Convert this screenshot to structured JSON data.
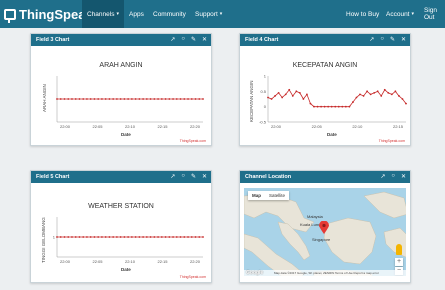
{
  "brand": {
    "name": "ThingSpeak",
    "tm": "™"
  },
  "nav": {
    "channels": "Channels",
    "apps": "Apps",
    "community": "Community",
    "support": "Support",
    "how_to_buy": "How to Buy",
    "account": "Account",
    "sign_out": "Sign Out"
  },
  "panel_icons": [
    "external-link-icon",
    "comment-icon",
    "pencil-icon",
    "close-icon"
  ],
  "charts": [
    {
      "header": "Field 3 Chart",
      "title": "ARAH ANGIN",
      "ylabel": "ARAH ANGIN",
      "xlabel": "Date",
      "credit": "ThingSpeak.com",
      "x_ticks": [
        "22:00",
        "22:05",
        "22:10",
        "22:15",
        "22:20"
      ]
    },
    {
      "header": "Field 4 Chart",
      "title": "KECEPATAN ANGIN",
      "ylabel": "KECEPATAN ANGIN",
      "xlabel": "Date",
      "credit": "ThingSpeak.com",
      "y_ticks": [
        "1",
        "0.5",
        "0",
        "-0.5"
      ],
      "x_ticks": [
        "22:00",
        "22:05",
        "22:10",
        "22:15"
      ]
    },
    {
      "header": "Field 5 Chart",
      "title": "WEATHER STATION",
      "ylabel": "TINGGI GELOMBANG",
      "xlabel": "Date",
      "credit": "ThingSpeak.com",
      "y_ticks": [
        "1"
      ],
      "x_ticks": [
        "22:00",
        "22:05",
        "22:10",
        "22:15",
        "22:20"
      ]
    }
  ],
  "map_panel": {
    "header": "Channel Location",
    "map_type_map": "Map",
    "map_type_sat": "Satellite",
    "labels": {
      "malaysia": "Malaysia",
      "kuala_lumpur": "Kuala Lumpur",
      "singapore": "Singapore"
    },
    "zoom_in": "+",
    "zoom_out": "−",
    "google": "Google",
    "footer": "Map data ©2017 Google, SK planet, ZENRIN  Terms of Use  Report a map error"
  },
  "chart_data": [
    {
      "type": "line",
      "title": "ARAH ANGIN",
      "xlabel": "Date",
      "ylabel": "ARAH ANGIN",
      "series": [
        {
          "values": [
            0,
            0,
            0,
            0,
            0,
            0,
            0,
            0,
            0,
            0,
            0,
            0,
            0,
            0,
            0,
            0,
            0,
            0,
            0,
            0,
            0,
            0,
            0,
            0,
            0,
            0,
            0,
            0,
            0,
            0,
            0,
            0,
            0,
            0,
            0,
            0,
            0,
            0,
            0,
            0
          ],
          "color": "#c62828"
        }
      ]
    },
    {
      "type": "line",
      "title": "KECEPATAN ANGIN",
      "xlabel": "Date",
      "ylabel": "KECEPATAN ANGIN",
      "ylim": [
        -0.5,
        1
      ],
      "series": [
        {
          "values": [
            0.3,
            0.25,
            0.35,
            0.45,
            0.3,
            0.4,
            0.55,
            0.35,
            0.5,
            0.45,
            0.25,
            0.4,
            0.1,
            0,
            0,
            0,
            0,
            0,
            0,
            0,
            0,
            0,
            0,
            0,
            0.15,
            0.3,
            0.4,
            0.35,
            0.5,
            0.4,
            0.45,
            0.5,
            0.35,
            0.55,
            0.45,
            0.4,
            0.5,
            0.35,
            0.25,
            0.1
          ],
          "color": "#c62828"
        }
      ]
    },
    {
      "type": "line",
      "title": "WEATHER STATION",
      "xlabel": "Date",
      "ylabel": "TINGGI GELOMBANG",
      "series": [
        {
          "values": [
            1,
            1,
            1,
            1,
            1,
            1,
            1,
            1,
            1,
            1,
            1,
            1,
            1,
            1,
            1,
            1,
            1,
            1,
            1,
            1,
            1,
            1,
            1,
            1,
            1,
            1,
            1,
            1,
            1,
            1,
            1,
            1,
            1,
            1,
            1,
            1,
            1,
            1,
            1,
            1
          ],
          "color": "#c62828"
        }
      ]
    }
  ]
}
